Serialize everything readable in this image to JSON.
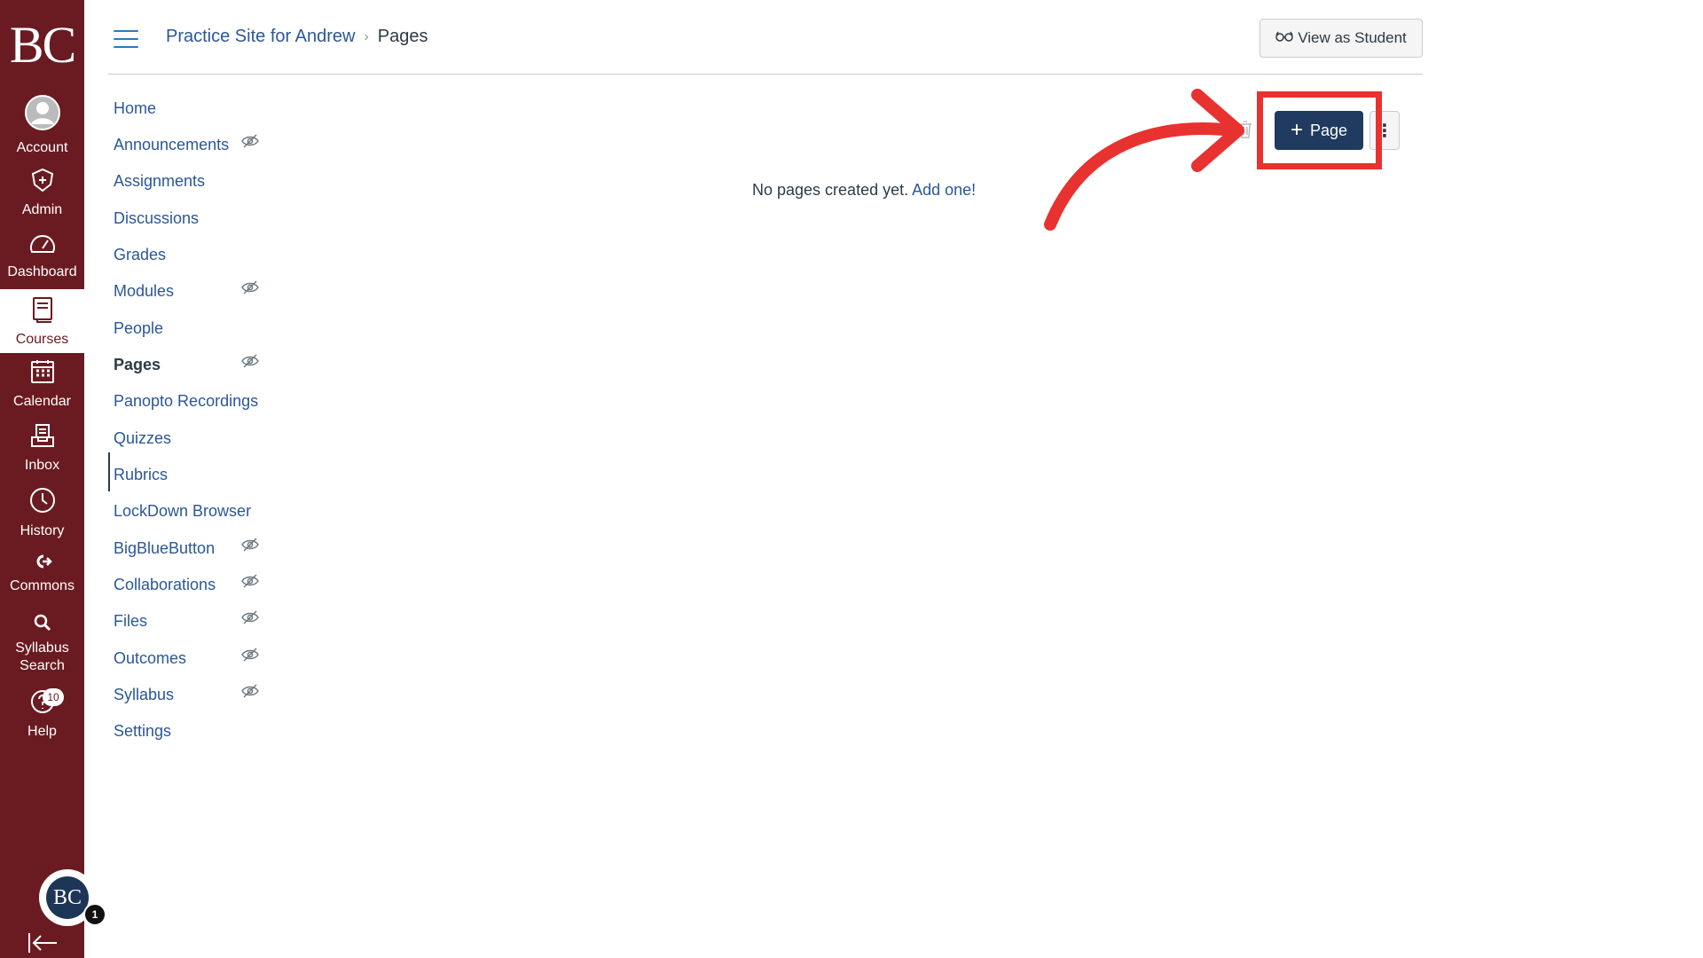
{
  "global_nav": {
    "logo": "BC",
    "items": [
      {
        "label": "Account",
        "icon": "account-icon"
      },
      {
        "label": "Admin",
        "icon": "admin-shield-icon"
      },
      {
        "label": "Dashboard",
        "icon": "dashboard-gauge-icon"
      },
      {
        "label": "Courses",
        "icon": "courses-book-icon",
        "active": true
      },
      {
        "label": "Calendar",
        "icon": "calendar-icon"
      },
      {
        "label": "Inbox",
        "icon": "inbox-icon"
      },
      {
        "label": "History",
        "icon": "history-clock-icon"
      },
      {
        "label": "Commons",
        "icon": "commons-icon"
      },
      {
        "label": "Syllabus Search",
        "icon": "syllabus-search-icon"
      },
      {
        "label": "Help",
        "icon": "help-icon",
        "badge": "10"
      }
    ],
    "brand_initials": "BC",
    "brand_badge": "1",
    "colors": {
      "nav_bg": "#6a1b21",
      "nav_text": "#ffffff"
    }
  },
  "header": {
    "breadcrumb": {
      "course": "Practice Site for Andrew",
      "current": "Pages"
    },
    "view_as_student_label": "View as Student"
  },
  "course_nav": {
    "items": [
      {
        "label": "Home",
        "hidden": false
      },
      {
        "label": "Announcements",
        "hidden": true
      },
      {
        "label": "Assignments",
        "hidden": false
      },
      {
        "label": "Discussions",
        "hidden": false
      },
      {
        "label": "Grades",
        "hidden": false
      },
      {
        "label": "Modules",
        "hidden": true
      },
      {
        "label": "People",
        "hidden": false
      },
      {
        "label": "Pages",
        "hidden": true,
        "active": true
      },
      {
        "label": "Panopto Recordings",
        "hidden": false
      },
      {
        "label": "Quizzes",
        "hidden": false
      },
      {
        "label": "Rubrics",
        "hidden": false
      },
      {
        "label": "LockDown Browser",
        "hidden": false
      },
      {
        "label": "BigBlueButton",
        "hidden": true
      },
      {
        "label": "Collaborations",
        "hidden": true
      },
      {
        "label": "Files",
        "hidden": true
      },
      {
        "label": "Outcomes",
        "hidden": true
      },
      {
        "label": "Syllabus",
        "hidden": true
      },
      {
        "label": "Settings",
        "hidden": false
      }
    ]
  },
  "content": {
    "empty_message": "No pages created yet.",
    "add_link": "Add one!",
    "add_page_button": {
      "plus": "+",
      "label": "Page"
    },
    "kebab_label": "⋮"
  },
  "colors": {
    "link": "#2b5797",
    "primary_button": "#213a5f",
    "annotation_red": "#e8322f"
  }
}
